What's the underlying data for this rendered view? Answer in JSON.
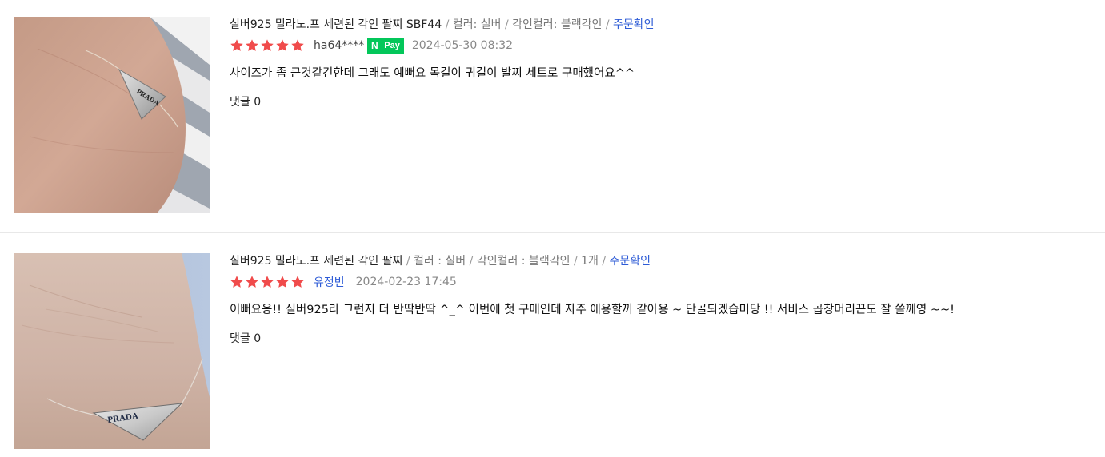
{
  "reviews": [
    {
      "product_name": "실버925 밀라노.프 세련된 각인 팔찌 SBF44",
      "option_color": "컬러: 실버",
      "option_engrave": "각인컬러: 블랙각인",
      "quantity": "",
      "order_check": "주문확인",
      "rating": 5,
      "username": "ha64****",
      "npay_badge": "Pay",
      "npay_n": "N",
      "date": "2024-05-30 08:32",
      "text": "사이즈가 좀 큰것같긴한데 그래도 예뻐요 목걸이 귀걸이 발찌 세트로 구매했어요^^",
      "comments": "댓글 0",
      "photo_engraving": "PRADA"
    },
    {
      "product_name": "실버925 밀라노.프 세련된 각인 팔찌",
      "option_color": "컬러 : 실버",
      "option_engrave": "각인컬러 : 블랙각인",
      "quantity": "1개",
      "order_check": "주문확인",
      "rating": 5,
      "username": "유정빈",
      "date": "2024-02-23 17:45",
      "text": "이뻐요옹!! 실버925라 그런지 더 반딱반딱 ^_^ 이번에 첫 구매인데 자주 애용할꺼 같아용 ~ 단골되겠습미당 !! 서비스 곱창머리끈도 잘 쓸께영 ~~!",
      "comments": "댓글 0",
      "photo_engraving": "PRADA"
    }
  ],
  "colors": {
    "star": "#f04b4b",
    "link": "#2d5bd6",
    "npay": "#03c75a"
  }
}
